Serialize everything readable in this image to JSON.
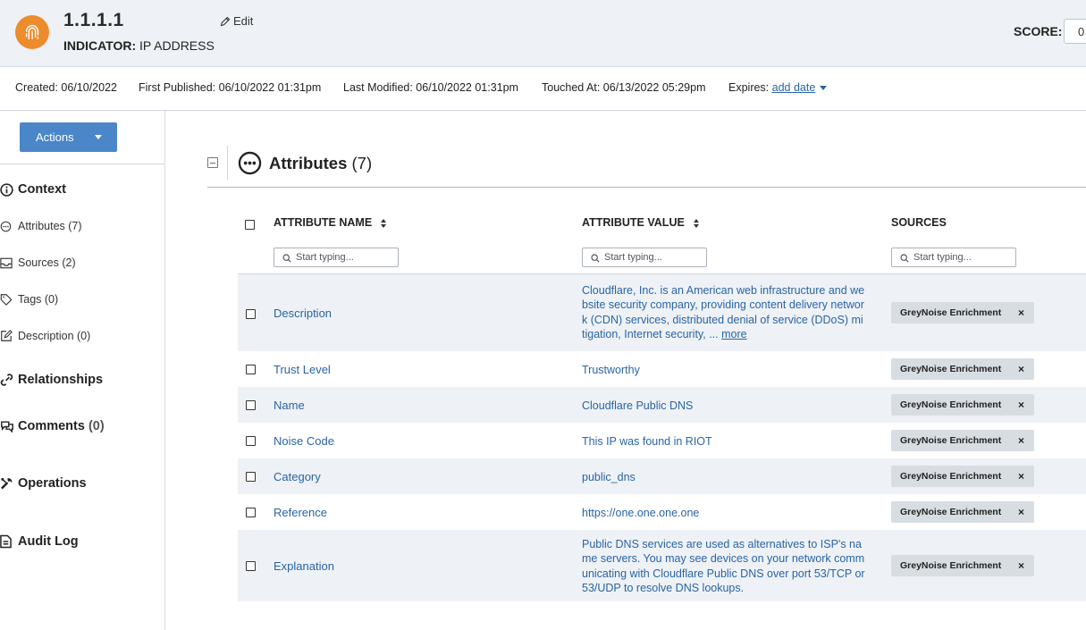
{
  "header": {
    "title": "1.1.1.1",
    "indicator_label": "INDICATOR:",
    "indicator_type": "IP ADDRESS",
    "edit_label": "Edit",
    "score_label": "SCORE:",
    "score_value": "0",
    "logo_icon": "fingerprint-icon",
    "logo_color": "#ec8c2c"
  },
  "meta": {
    "created": "Created: 06/10/2022",
    "first_published": "First Published: 06/10/2022 01:31pm",
    "last_modified": "Last Modified: 06/10/2022 01:31pm",
    "touched_at": "Touched At: 06/13/2022 05:29pm",
    "expires_label": "Expires:",
    "expires_link": "add date"
  },
  "sidebar": {
    "actions_label": "Actions",
    "items": [
      {
        "label": "Context",
        "icon": "info-icon"
      },
      {
        "label": "Attributes (7)",
        "icon": "ellipsis-circle-icon"
      },
      {
        "label": "Sources (2)",
        "icon": "inbox-icon"
      },
      {
        "label": "Tags (0)",
        "icon": "tag-icon"
      },
      {
        "label": "Description (0)",
        "icon": "edit-icon"
      },
      {
        "label": "Relationships",
        "icon": "link-icon"
      },
      {
        "label": "Comments",
        "count": "(0)",
        "icon": "comments-icon"
      },
      {
        "label": "Operations",
        "icon": "tools-icon"
      },
      {
        "label": "Audit Log",
        "icon": "file-icon"
      }
    ]
  },
  "section": {
    "title": "Attributes",
    "count": "(7)"
  },
  "table": {
    "columns": [
      "ATTRIBUTE NAME",
      "ATTRIBUTE VALUE",
      "SOURCES"
    ],
    "filter_placeholder": "Start typing...",
    "rows": [
      {
        "name": "Description",
        "value": "Cloudflare, Inc. is an American web infrastructure and website security company, providing content delivery network (CDN) services, distributed denial of service (DDoS) mitigation, Internet security, ...",
        "more": "more",
        "source": "GreyNoise Enrichment"
      },
      {
        "name": "Trust Level",
        "value": "Trustworthy",
        "source": "GreyNoise Enrichment"
      },
      {
        "name": "Name",
        "value": "Cloudflare Public DNS",
        "source": "GreyNoise Enrichment"
      },
      {
        "name": "Noise Code",
        "value": "This IP was found in RIOT",
        "source": "GreyNoise Enrichment"
      },
      {
        "name": "Category",
        "value": "public_dns",
        "source": "GreyNoise Enrichment"
      },
      {
        "name": "Reference",
        "value": "https://one.one.one.one",
        "source": "GreyNoise Enrichment"
      },
      {
        "name": "Explanation",
        "value": "Public DNS services are used as alternatives to ISP's name servers. You may see devices on your network communicating with Cloudflare Public DNS over port 53/TCP or 53/UDP to resolve DNS lookups.",
        "source": "GreyNoise Enrichment"
      }
    ],
    "remove_glyph": "×"
  }
}
